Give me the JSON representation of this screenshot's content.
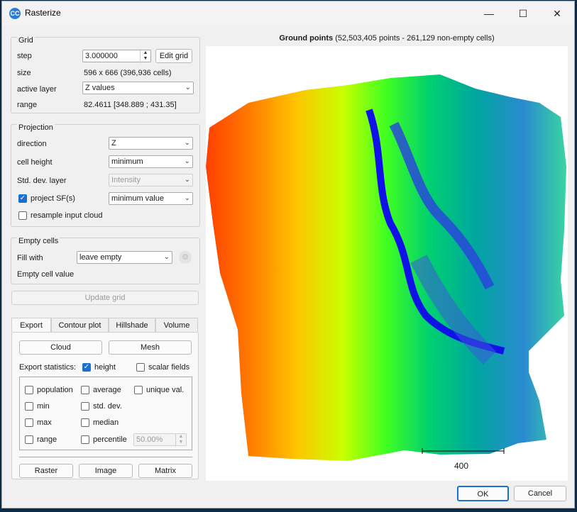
{
  "window": {
    "title": "Rasterize",
    "app_icon": "CC"
  },
  "grid": {
    "group_label": "Grid",
    "step_label": "step",
    "step_value": "3.000000",
    "edit_grid_label": "Edit grid",
    "size_label": "size",
    "size_value": "596 x 666 (396,936 cells)",
    "active_layer_label": "active layer",
    "active_layer_value": "Z values",
    "range_label": "range",
    "range_value": "82.4611 [348.889 ; 431.35]"
  },
  "projection": {
    "group_label": "Projection",
    "direction_label": "direction",
    "direction_value": "Z",
    "cell_height_label": "cell height",
    "cell_height_value": "minimum",
    "std_dev_label": "Std. dev. layer",
    "std_dev_value": "Intensity",
    "project_sf_label": "project SF(s)",
    "project_sf_value": "minimum value",
    "resample_label": "resample input cloud"
  },
  "empty_cells": {
    "group_label": "Empty cells",
    "fill_with_label": "Fill with",
    "fill_with_value": "leave empty",
    "empty_value_label": "Empty cell value"
  },
  "update_grid_label": "Update grid",
  "tabs": [
    "Export",
    "Contour plot",
    "Hillshade",
    "Volume"
  ],
  "export": {
    "cloud_label": "Cloud",
    "mesh_label": "Mesh",
    "stats_label": "Export statistics:",
    "height_label": "height",
    "scalar_fields_label": "scalar fields",
    "population_label": "population",
    "average_label": "average",
    "unique_val_label": "unique val.",
    "min_label": "min",
    "std_dev_label": "std. dev.",
    "max_label": "max",
    "median_label": "median",
    "range_label": "range",
    "percentile_label": "percentile",
    "percentile_value": "50.00%",
    "raster_label": "Raster",
    "image_label": "Image",
    "matrix_label": "Matrix"
  },
  "plot": {
    "title_bold": "Ground points",
    "title_rest": " (52,503,405 points - 261,129 non-empty cells)",
    "scale_label": "400"
  },
  "footer": {
    "ok_label": "OK",
    "cancel_label": "Cancel"
  }
}
